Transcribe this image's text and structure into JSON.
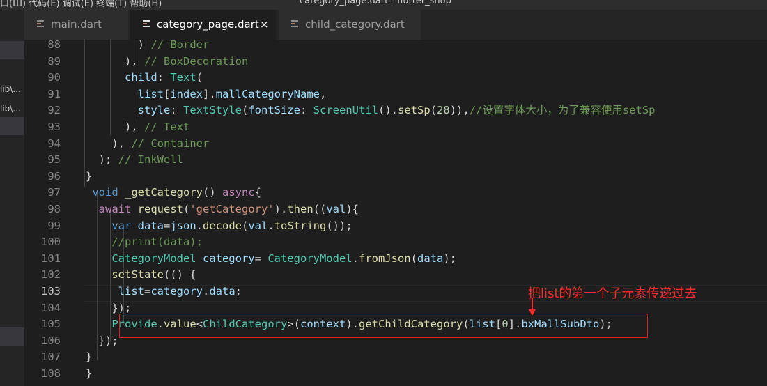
{
  "menubar": {
    "text": "口(Ш)   代码(E)   调试(E)   终端(T)   帮助(H)",
    "title": "category_page.dart - flutter_shop"
  },
  "sidebar": {
    "items": [
      "lib\\...",
      "lib\\..."
    ]
  },
  "tabs": [
    {
      "label": "main.dart",
      "active": false
    },
    {
      "label": "category_page.dart",
      "active": true,
      "close": "×"
    },
    {
      "label": "child_category.dart",
      "active": false
    }
  ],
  "colors": {
    "annotation": "#ff2a2a",
    "highlight_box": "#e02020",
    "editor_bg": "#1e1e1e"
  },
  "editor": {
    "current_line": "103",
    "lines": [
      {
        "num": "88",
        "tokens": [
          [
            "p",
            "        ) "
          ],
          [
            "c",
            "// Border"
          ]
        ]
      },
      {
        "num": "89",
        "tokens": [
          [
            "p",
            "      ), "
          ],
          [
            "c",
            "// BoxDecoration"
          ]
        ]
      },
      {
        "num": "90",
        "tokens": [
          [
            "v",
            "      child"
          ],
          [
            "p",
            ": "
          ],
          [
            "t",
            "Text"
          ],
          [
            "p",
            "("
          ]
        ]
      },
      {
        "num": "91",
        "tokens": [
          [
            "v",
            "        list"
          ],
          [
            "p",
            "["
          ],
          [
            "v",
            "index"
          ],
          [
            "p",
            "]."
          ],
          [
            "v",
            "mallCategoryName"
          ],
          [
            "p",
            ","
          ]
        ]
      },
      {
        "num": "92",
        "tokens": [
          [
            "v",
            "        style"
          ],
          [
            "p",
            ": "
          ],
          [
            "t",
            "TextStyle"
          ],
          [
            "p",
            "("
          ],
          [
            "v",
            "fontSize"
          ],
          [
            "p",
            ": "
          ],
          [
            "t",
            "ScreenUtil"
          ],
          [
            "p",
            "()."
          ],
          [
            "f",
            "setSp"
          ],
          [
            "p",
            "("
          ],
          [
            "n",
            "28"
          ],
          [
            "p",
            ")),"
          ],
          [
            "c",
            "//设置字体大小，为了兼容使用setSp"
          ]
        ]
      },
      {
        "num": "93",
        "tokens": [
          [
            "p",
            "      ), "
          ],
          [
            "c",
            "// Text"
          ]
        ]
      },
      {
        "num": "94",
        "tokens": [
          [
            "p",
            "    ), "
          ],
          [
            "c",
            "// Container"
          ]
        ]
      },
      {
        "num": "95",
        "tokens": [
          [
            "p",
            "  ); "
          ],
          [
            "c",
            "// InkWell"
          ]
        ]
      },
      {
        "num": "96",
        "tokens": [
          [
            "p",
            "}"
          ]
        ]
      },
      {
        "num": "97",
        "tokens": [
          [
            "k",
            " void "
          ],
          [
            "f",
            "_getCategory"
          ],
          [
            "p",
            "() "
          ],
          [
            "cf",
            "async"
          ],
          [
            "p",
            "{"
          ]
        ]
      },
      {
        "num": "98",
        "tokens": [
          [
            "cf",
            "  await "
          ],
          [
            "f",
            "request"
          ],
          [
            "p",
            "("
          ],
          [
            "s",
            "'getCategory'"
          ],
          [
            "p",
            ")."
          ],
          [
            "f",
            "then"
          ],
          [
            "p",
            "(("
          ],
          [
            "v",
            "val"
          ],
          [
            "p",
            "){"
          ]
        ]
      },
      {
        "num": "99",
        "tokens": [
          [
            "k",
            "    var "
          ],
          [
            "v",
            "data"
          ],
          [
            "p",
            "="
          ],
          [
            "v",
            "json"
          ],
          [
            "p",
            "."
          ],
          [
            "f",
            "decode"
          ],
          [
            "p",
            "("
          ],
          [
            "v",
            "val"
          ],
          [
            "p",
            "."
          ],
          [
            "f",
            "toString"
          ],
          [
            "p",
            "());"
          ]
        ]
      },
      {
        "num": "100",
        "tokens": [
          [
            "c",
            "    //print(data);"
          ]
        ]
      },
      {
        "num": "101",
        "tokens": [
          [
            "t",
            "    CategoryModel "
          ],
          [
            "v",
            "category"
          ],
          [
            "p",
            "= "
          ],
          [
            "t",
            "CategoryModel"
          ],
          [
            "p",
            "."
          ],
          [
            "f",
            "fromJson"
          ],
          [
            "p",
            "("
          ],
          [
            "v",
            "data"
          ],
          [
            "p",
            ");"
          ]
        ]
      },
      {
        "num": "102",
        "tokens": [
          [
            "f",
            "    setState"
          ],
          [
            "p",
            "(() {"
          ]
        ]
      },
      {
        "num": "103",
        "tokens": [
          [
            "v",
            "     list"
          ],
          [
            "p",
            "="
          ],
          [
            "v",
            "category"
          ],
          [
            "p",
            "."
          ],
          [
            "v",
            "data"
          ],
          [
            "p",
            ";"
          ]
        ]
      },
      {
        "num": "104",
        "tokens": [
          [
            "p",
            "    });"
          ]
        ]
      },
      {
        "num": "105",
        "tokens": [
          [
            "t",
            "    Provide"
          ],
          [
            "p",
            "."
          ],
          [
            "f",
            "value"
          ],
          [
            "p",
            "<"
          ],
          [
            "t",
            "ChildCategory"
          ],
          [
            "p",
            ">("
          ],
          [
            "v",
            "context"
          ],
          [
            "p",
            ")."
          ],
          [
            "f",
            "getChildCategory"
          ],
          [
            "p",
            "("
          ],
          [
            "v",
            "list"
          ],
          [
            "p",
            "["
          ],
          [
            "n",
            "0"
          ],
          [
            "p",
            "]."
          ],
          [
            "v",
            "bxMallSubDto"
          ],
          [
            "p",
            ");"
          ]
        ]
      },
      {
        "num": "106",
        "tokens": [
          [
            "p",
            "  });"
          ]
        ]
      },
      {
        "num": "107",
        "tokens": [
          [
            "p",
            "}"
          ]
        ]
      },
      {
        "num": "108",
        "tokens": [
          [
            "p",
            "}"
          ]
        ]
      }
    ]
  },
  "annotation": {
    "text": "把list的第一个子元素传递过去"
  }
}
